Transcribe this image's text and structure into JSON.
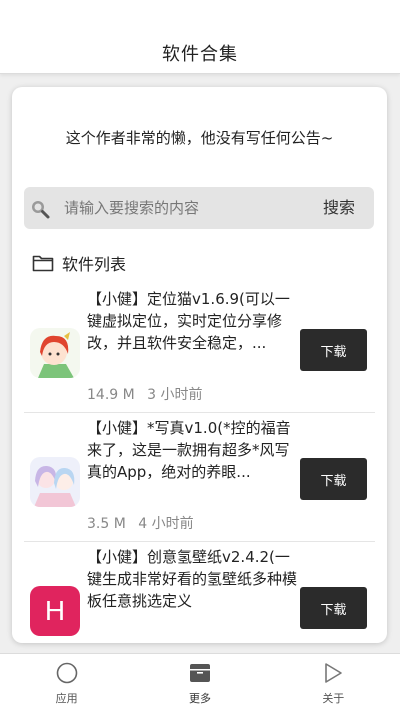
{
  "header": {
    "title": "软件合集"
  },
  "notice": {
    "text": "这个作者非常的懒，他没有写任何公告~"
  },
  "search": {
    "placeholder": "请输入要搜索的内容",
    "button_label": "搜索"
  },
  "section": {
    "title": "软件列表"
  },
  "apps": [
    {
      "title": "【小健】定位猫v1.6.9(可以一键虚拟定位，实时定位分享修改，并且软件安全稳定，...",
      "size": "14.9 M",
      "time": "3 小时前",
      "download_label": "下载",
      "icon": "anime-red-hair-icon"
    },
    {
      "title": "【小健】*写真v1.0(*控的福音来了，这是一款拥有超多*风写真的App，绝对的养眼...",
      "size": "3.5 M",
      "time": "4 小时前",
      "download_label": "下载",
      "icon": "anime-girls-icon"
    },
    {
      "title": "【小健】创意氢壁纸v2.4.2(一键生成非常好看的氢壁纸多种模板任意挑选定义",
      "size": "",
      "time": "",
      "download_label": "下载",
      "icon": "letter-h-icon",
      "icon_letter": "H"
    }
  ],
  "tabbar": {
    "tabs": [
      {
        "label": "应用",
        "icon": "circle-icon"
      },
      {
        "label": "更多",
        "icon": "box-icon"
      },
      {
        "label": "关于",
        "icon": "play-icon"
      }
    ]
  },
  "colors": {
    "button": "#2b2b2b",
    "h_icon": "#e0245e",
    "background": "#efefef"
  }
}
